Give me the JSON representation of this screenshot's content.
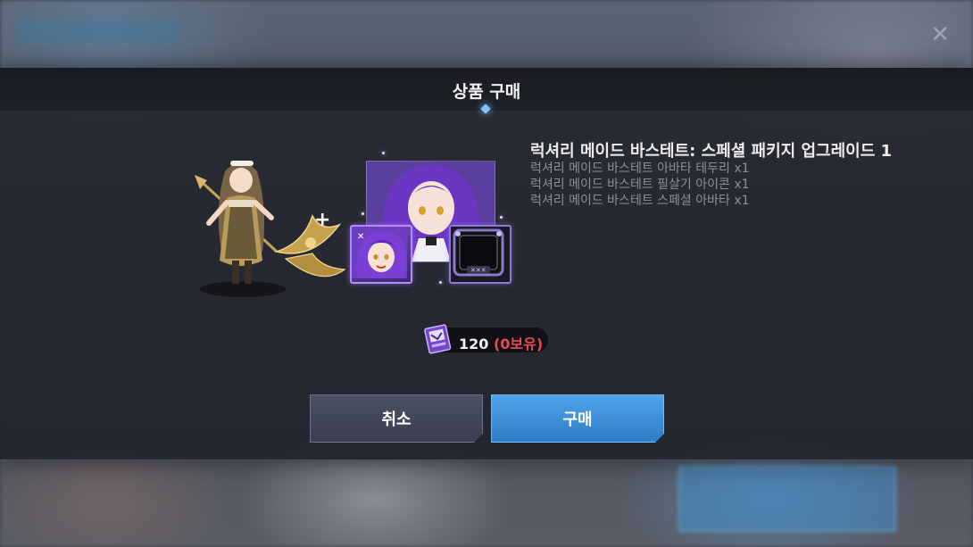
{
  "dialog": {
    "title": "상품 구매"
  },
  "product": {
    "name": "럭셔리 메이드 바스테트: 스페셜 패키지 업그레이드 1",
    "contents": [
      "럭셔리 메이드 바스테트 아바타 테두리 x1",
      "럭셔리 메이드 바스테트 필살기 아이콘 x1",
      "럭셔리 메이드 바스테트 스페셜 아바타 x1"
    ],
    "plus_symbol": "+"
  },
  "price": {
    "amount": "120",
    "owned": "(0보유)",
    "currency_icon": "ticket-icon"
  },
  "buttons": {
    "cancel": "취소",
    "buy": "구매"
  },
  "colors": {
    "buy_button": "#3a8ed8",
    "cancel_button": "#444859",
    "owned_warning": "#e84b4b",
    "accent_diamond": "#7fc3ff"
  }
}
